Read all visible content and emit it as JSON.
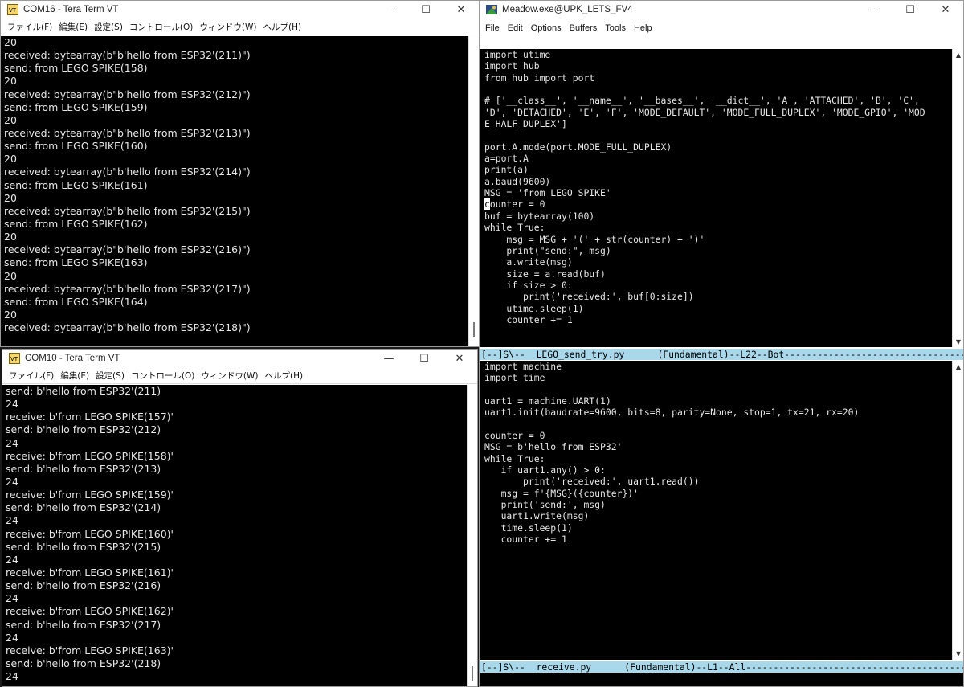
{
  "com16": {
    "title": "COM16 - Tera Term VT",
    "menu": [
      "ファイル(F)",
      "編集(E)",
      "設定(S)",
      "コントロール(O)",
      "ウィンドウ(W)",
      "ヘルプ(H)"
    ],
    "lines": [
      "20",
      "received: bytearray(b\"b'hello from ESP32'(211)\")",
      "send: from LEGO SPIKE(158)",
      "20",
      "received: bytearray(b\"b'hello from ESP32'(212)\")",
      "send: from LEGO SPIKE(159)",
      "20",
      "received: bytearray(b\"b'hello from ESP32'(213)\")",
      "send: from LEGO SPIKE(160)",
      "20",
      "received: bytearray(b\"b'hello from ESP32'(214)\")",
      "send: from LEGO SPIKE(161)",
      "20",
      "received: bytearray(b\"b'hello from ESP32'(215)\")",
      "send: from LEGO SPIKE(162)",
      "20",
      "received: bytearray(b\"b'hello from ESP32'(216)\")",
      "send: from LEGO SPIKE(163)",
      "20",
      "received: bytearray(b\"b'hello from ESP32'(217)\")",
      "send: from LEGO SPIKE(164)",
      "20",
      "received: bytearray(b\"b'hello from ESP32'(218)\")"
    ]
  },
  "com10": {
    "title": "COM10 - Tera Term VT",
    "menu": [
      "ファイル(F)",
      "編集(E)",
      "設定(S)",
      "コントロール(O)",
      "ウィンドウ(W)",
      "ヘルプ(H)"
    ],
    "lines": [
      "send: b'hello from ESP32'(211)",
      "24",
      "receive: b'from LEGO SPIKE(157)'",
      "send: b'hello from ESP32'(212)",
      "24",
      "receive: b'from LEGO SPIKE(158)'",
      "send: b'hello from ESP32'(213)",
      "24",
      "receive: b'from LEGO SPIKE(159)'",
      "send: b'hello from ESP32'(214)",
      "24",
      "receive: b'from LEGO SPIKE(160)'",
      "send: b'hello from ESP32'(215)",
      "24",
      "receive: b'from LEGO SPIKE(161)'",
      "send: b'hello from ESP32'(216)",
      "24",
      "receive: b'from LEGO SPIKE(162)'",
      "send: b'hello from ESP32'(217)",
      "24",
      "receive: b'from LEGO SPIKE(163)'",
      "send: b'hello from ESP32'(218)",
      "24"
    ]
  },
  "meadow": {
    "title": "Meadow.exe@UPK_LETS_FV4",
    "menu": [
      "File",
      "Edit",
      "Options",
      "Buffers",
      "Tools",
      "Help"
    ],
    "top_lines": [
      "import utime",
      "import hub",
      "from hub import port",
      "",
      "# ['__class__', '__name__', '__bases__', '__dict__', 'A', 'ATTACHED', 'B', 'C', ",
      "'D', 'DETACHED', 'E', 'F', 'MODE_DEFAULT', 'MODE_FULL_DUPLEX', 'MODE_GPIO', 'MOD",
      "E_HALF_DUPLEX']",
      "",
      "port.A.mode(port.MODE_FULL_DUPLEX)",
      "a=port.A",
      "print(a)",
      "a.baud(9600)",
      "MSG = 'from LEGO SPIKE'",
      "counter = 0",
      "buf = bytearray(100)",
      "while True:",
      "    msg = MSG + '(' + str(counter) + ')'",
      "    print(\"send:\", msg)",
      "    a.write(msg)",
      "    size = a.read(buf)",
      "    if size > 0:",
      "       print('received:', buf[0:size])",
      "    utime.sleep(1)",
      "    counter += 1"
    ],
    "top_modeline": "[--]S\\--  LEGO_send_try.py      (Fundamental)--L22--Bot--------------------------------------------",
    "bottom_lines": [
      "import machine",
      "import time",
      "",
      "uart1 = machine.UART(1)",
      "uart1.init(baudrate=9600, bits=8, parity=None, stop=1, tx=21, rx=20)",
      "",
      "counter = 0",
      "MSG = b'hello from ESP32'",
      "while True:",
      "   if uart1.any() > 0:",
      "       print('received:', uart1.read())",
      "   msg = f'{MSG}({counter})'",
      "   print('send:', msg)",
      "   uart1.write(msg)",
      "   time.sleep(1)",
      "   counter += 1"
    ],
    "bottom_modeline": "[--]S\\--  receive.py      (Fundamental)--L1--All------------------------------------------------"
  },
  "window_controls": {
    "minimize": "—",
    "maximize": "☐",
    "close": "✕"
  },
  "colors": {
    "modeline": "#a8d8ea",
    "terminal_bg": "#000000",
    "terminal_fg": "#e6e6e6"
  }
}
